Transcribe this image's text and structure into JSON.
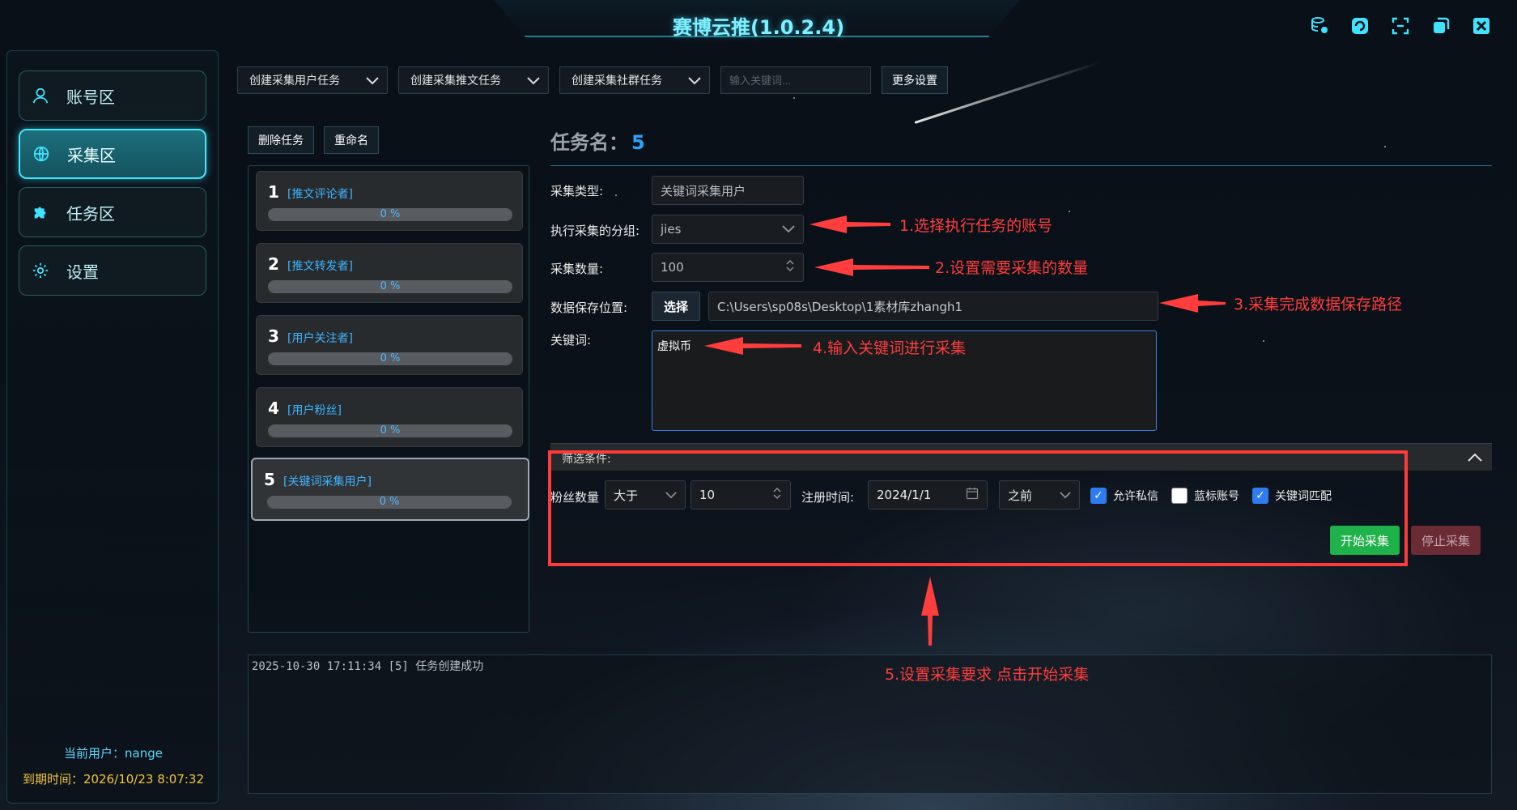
{
  "app": {
    "title": "赛博云推(1.0.2.4)",
    "window_controls": [
      "database-icon",
      "refresh-icon",
      "fullscreen-icon",
      "restore-icon",
      "close-icon"
    ]
  },
  "sidebar": {
    "items": [
      {
        "label": "账号区",
        "icon": "user-icon",
        "active": false
      },
      {
        "label": "采集区",
        "icon": "globe-icon",
        "active": true
      },
      {
        "label": "任务区",
        "icon": "puzzle-icon",
        "active": false
      },
      {
        "label": "设置",
        "icon": "gear-icon",
        "active": false
      }
    ],
    "current_user": "当前用户：nange",
    "expire_time": "到期时间：2026/10/23 8:07:32"
  },
  "toolbar": {
    "create_user_task": "创建采集用户任务",
    "create_tweet_task": "创建采集推文任务",
    "create_group_task": "创建采集社群任务",
    "keyword_placeholder": "输入关键词...",
    "more_settings": "更多设置"
  },
  "task_actions": {
    "delete": "删除任务",
    "rename": "重命名"
  },
  "tasks": [
    {
      "num": "1",
      "type": "[推文评论者]",
      "progress_text": "0 %",
      "progress": 0
    },
    {
      "num": "2",
      "type": "[推文转发者]",
      "progress_text": "0 %",
      "progress": 0
    },
    {
      "num": "3",
      "type": "[用户关注者]",
      "progress_text": "0 %",
      "progress": 0
    },
    {
      "num": "4",
      "type": "[用户粉丝]",
      "progress_text": "0 %",
      "progress": 0
    },
    {
      "num": "5",
      "type": "[关键词采集用户]",
      "progress_text": "0 %",
      "progress": 0
    }
  ],
  "detail": {
    "title_label": "任务名：",
    "title_num": "5",
    "collect_type_label": "采集类型:",
    "collect_type_value": "关键词采集用户",
    "group_label": "执行采集的分组:",
    "group_value": "jies",
    "count_label": "采集数量:",
    "count_value": "100",
    "save_label": "数据保存位置:",
    "save_button": "选择",
    "save_path": "C:\\Users\\sp08s\\Desktop\\1素材库zhangh1",
    "keyword_label": "关键词:",
    "keyword_value": "虚拟币"
  },
  "filter": {
    "header": "筛选条件:",
    "fans_label": "粉丝数量",
    "fans_op": "大于",
    "fans_value": "10",
    "reg_label": "注册时间:",
    "reg_date": "2024/1/1",
    "reg_op": "之前",
    "allow_dm": {
      "label": "允许私信",
      "checked": true
    },
    "blue_account": {
      "label": "蓝标账号",
      "checked": false
    },
    "keyword_match": {
      "label": "关键词匹配",
      "checked": true
    },
    "start_button": "开始采集",
    "stop_button": "停止采集"
  },
  "log": {
    "lines": [
      "2025-10-30 17:11:34 [5] 任务创建成功"
    ]
  },
  "annotations": {
    "a1": "1.选择执行任务的账号",
    "a2": "2.设置需要采集的数量",
    "a3": "3.采集完成数据保存路径",
    "a4": "4.输入关键词进行采集",
    "a5": "5.设置采集要求 点击开始采集"
  },
  "colors": {
    "accent_cyan": "#3fe3ff",
    "progress_blue": "#2aa4ff",
    "annotation_red": "#ff3d3d",
    "start_green": "#1fb14a",
    "expire_yellow": "#f0c542"
  }
}
